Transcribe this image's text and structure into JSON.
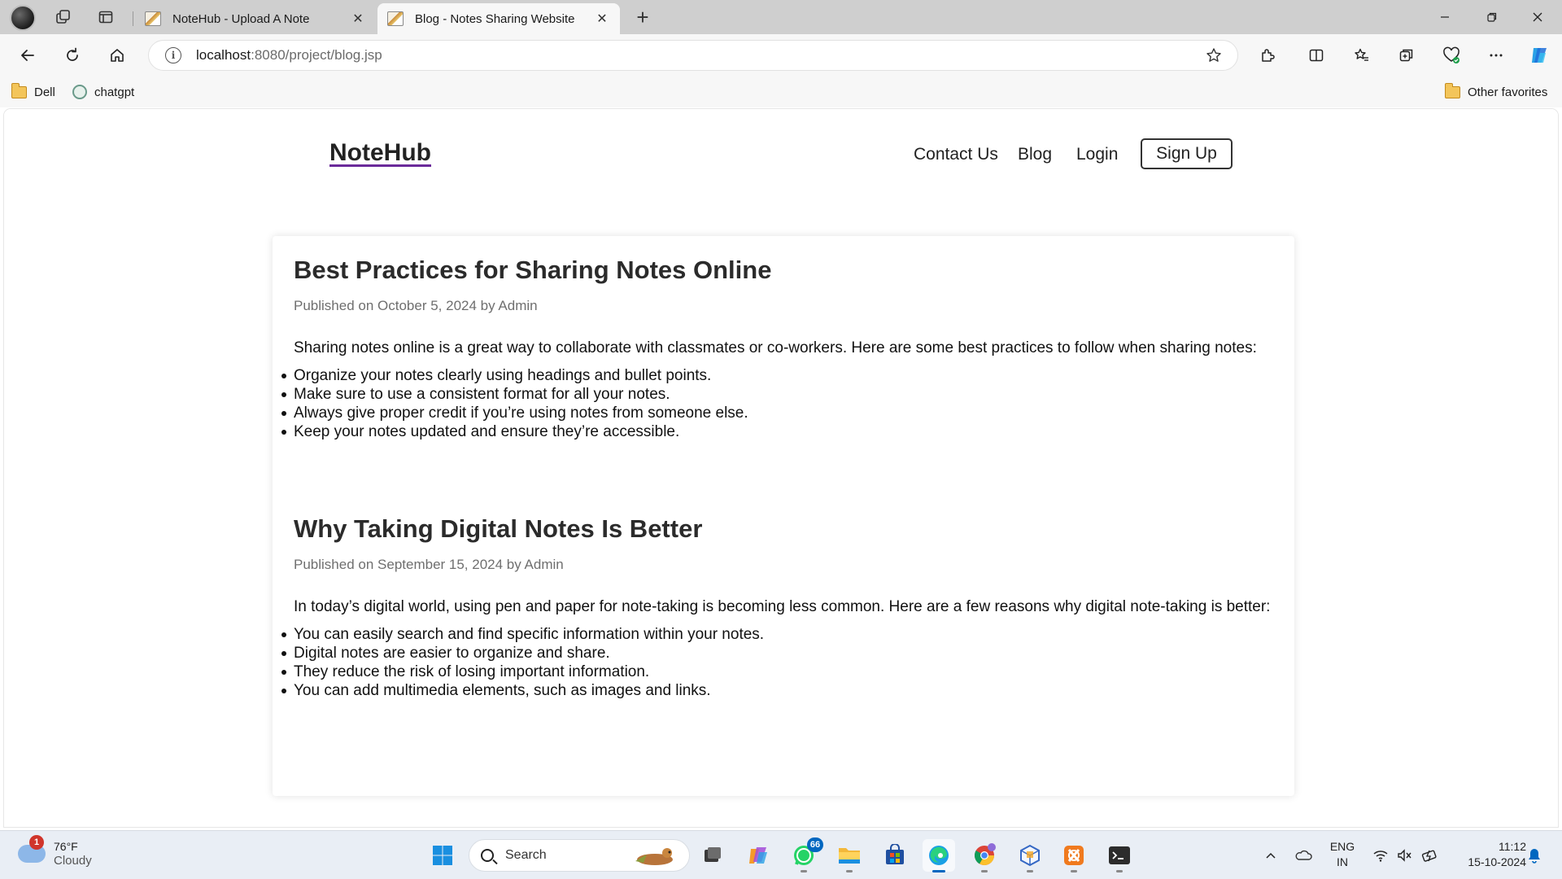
{
  "browser": {
    "tabs": [
      {
        "title": "NoteHub - Upload A Note",
        "active": false
      },
      {
        "title": "Blog - Notes Sharing Website",
        "active": true
      }
    ],
    "url_host": "localhost",
    "url_rest": ":8080/project/blog.jsp",
    "favorites": [
      {
        "label": "Dell",
        "icon": "folder-icon"
      },
      {
        "label": "chatgpt",
        "icon": "chatgpt-icon"
      }
    ],
    "other_favorites": "Other favorites"
  },
  "site": {
    "brand": "NoteHub",
    "nav": {
      "contact": "Contact Us",
      "blog": "Blog",
      "login": "Login",
      "signup": "Sign Up"
    }
  },
  "posts": [
    {
      "title": "Best Practices for Sharing Notes Online",
      "meta": "Published on October 5, 2024 by Admin",
      "lead": "Sharing notes online is a great way to collaborate with classmates or co-workers. Here are some best practices to follow when sharing notes:",
      "items": [
        "Organize your notes clearly using headings and bullet points.",
        "Make sure to use a consistent format for all your notes.",
        "Always give proper credit if you’re using notes from someone else.",
        "Keep your notes updated and ensure they’re accessible."
      ]
    },
    {
      "title": "Why Taking Digital Notes Is Better",
      "meta": "Published on September 15, 2024 by Admin",
      "lead": "In today’s digital world, using pen and paper for note-taking is becoming less common. Here are a few reasons why digital note-taking is better:",
      "items": [
        "You can easily search and find specific information within your notes.",
        "Digital notes are easier to organize and share.",
        "They reduce the risk of losing important information.",
        "You can add multimedia elements, such as images and links."
      ]
    }
  ],
  "taskbar": {
    "weather_temp": "76°F",
    "weather_desc": "Cloudy",
    "weather_badge": "1",
    "search_label": "Search",
    "whatsapp_badge": "66",
    "lang_line1": "ENG",
    "lang_line2": "IN",
    "time": "11:12",
    "date": "15-10-2024"
  },
  "colors": {
    "accent": "#0067c0",
    "brand_underline": "#6a2a9a"
  }
}
